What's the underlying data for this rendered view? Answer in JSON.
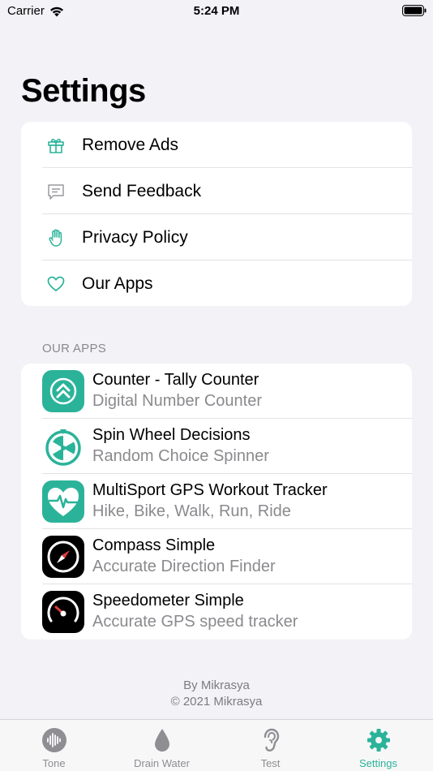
{
  "status_bar": {
    "carrier": "Carrier",
    "time": "5:24 PM"
  },
  "page": {
    "title": "Settings"
  },
  "colors": {
    "accent": "#2bb39a",
    "secondary_text": "#8a8a8e",
    "background": "#f2f2f7"
  },
  "settings": {
    "items": [
      {
        "label": "Remove Ads",
        "icon": "gift-icon"
      },
      {
        "label": "Send Feedback",
        "icon": "message-icon"
      },
      {
        "label": "Privacy Policy",
        "icon": "hand-icon"
      },
      {
        "label": "Our Apps",
        "icon": "heart-icon"
      }
    ]
  },
  "our_apps": {
    "header": "OUR APPS",
    "apps": [
      {
        "title": "Counter - Tally Counter",
        "subtitle": "Digital Number Counter",
        "icon": "counter-app-icon"
      },
      {
        "title": "Spin Wheel Decisions",
        "subtitle": "Random Choice Spinner",
        "icon": "spin-wheel-app-icon"
      },
      {
        "title": "MultiSport GPS Workout Tracker",
        "subtitle": "Hike, Bike, Walk, Run, Ride",
        "icon": "heart-pulse-app-icon"
      },
      {
        "title": "Compass Simple",
        "subtitle": "Accurate Direction Finder",
        "icon": "compass-app-icon"
      },
      {
        "title": "Speedometer Simple",
        "subtitle": "Accurate GPS speed tracker",
        "icon": "speedometer-app-icon"
      }
    ]
  },
  "footer": {
    "by": "By Mikrasya",
    "copyright": "© 2021 Mikrasya"
  },
  "tab_bar": {
    "tabs": [
      {
        "label": "Tone",
        "icon": "waveform-icon"
      },
      {
        "label": "Drain Water",
        "icon": "water-drop-icon"
      },
      {
        "label": "Test",
        "icon": "ear-icon"
      },
      {
        "label": "Settings",
        "icon": "gear-icon"
      }
    ],
    "active": "Settings"
  }
}
